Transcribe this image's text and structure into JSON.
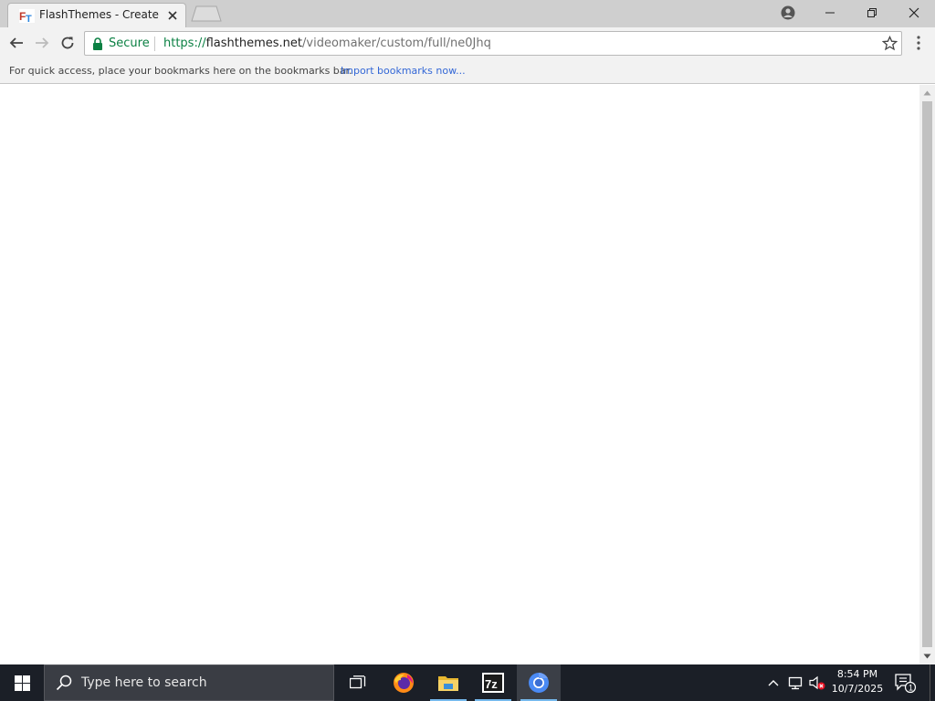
{
  "browser": {
    "tab": {
      "title": "FlashThemes - Create"
    },
    "omnibox": {
      "security_label": "Secure",
      "url_scheme": "https://",
      "url_host": "flashthemes.net",
      "url_path": "/videomaker/custom/full/ne0Jhq"
    },
    "bookmarks_bar": {
      "message": "For quick access, place your bookmarks here on the bookmarks bar.",
      "import_link": "Import bookmarks now..."
    }
  },
  "taskbar": {
    "search_placeholder": "Type here to search",
    "pinned_apps": [
      "task-view",
      "firefox",
      "file-explorer",
      "7-zip",
      "chrome"
    ],
    "clock": {
      "time": "8:54 PM",
      "date": "10/7/2025"
    },
    "notifications_count": "1"
  },
  "colors": {
    "secure_green": "#0b8043",
    "link_blue": "#3367d6",
    "taskbar_bg": "#1b1f27",
    "tab_strip_bg": "#cfcfcf",
    "toolbar_bg": "#f2f2f2"
  }
}
